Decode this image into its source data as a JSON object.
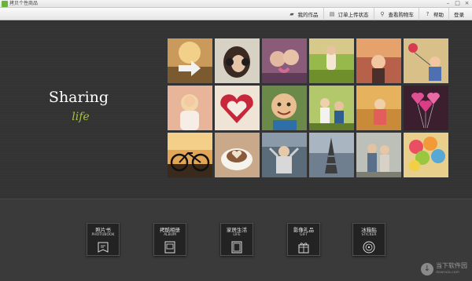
{
  "window": {
    "title": "拷贝个性商品"
  },
  "nav": {
    "items": [
      {
        "label": "我的作品",
        "icon": "folder-icon"
      },
      {
        "label": "订单上传状态",
        "icon": "upload-icon"
      },
      {
        "label": "查看购物车",
        "icon": "search-icon"
      },
      {
        "label": "帮助",
        "icon": "help-icon"
      },
      {
        "label": "登录",
        "icon": ""
      }
    ]
  },
  "hero": {
    "title": "Sharing",
    "subtitle": "life"
  },
  "categories": [
    {
      "cn": "照片书",
      "en": "PHOTOBOOK",
      "icon": "photobook-icon"
    },
    {
      "cn": "拷酷相册",
      "en": "ALBUM",
      "icon": "album-icon"
    },
    {
      "cn": "家居生活",
      "en": "LIFE",
      "icon": "frame-icon"
    },
    {
      "cn": "影像礼品",
      "en": "GIFT",
      "icon": "gift-icon"
    },
    {
      "cn": "冰箱贴",
      "en": "STICKER",
      "icon": "sticker-icon"
    }
  ],
  "watermark": {
    "text": "当下软件园",
    "url": "downxia.com"
  },
  "colors": {
    "accent": "#a6c53a",
    "background": "#333333",
    "bottom": "#3a3a3a"
  }
}
